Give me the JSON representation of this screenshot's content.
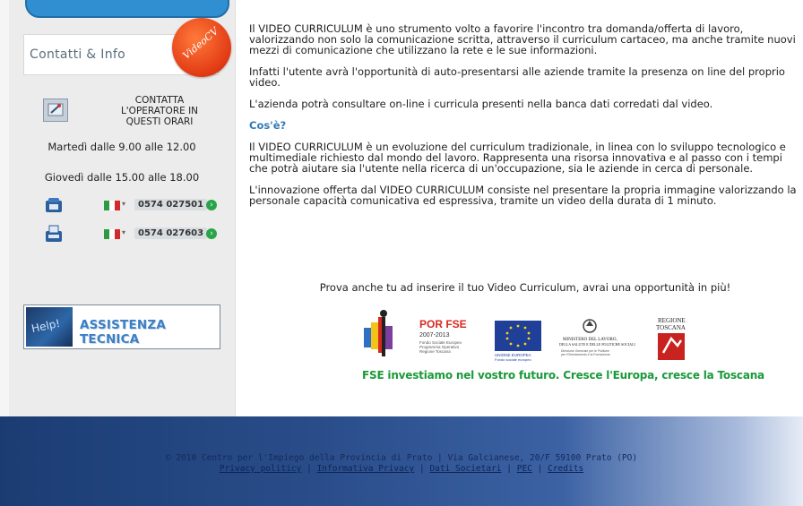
{
  "sidebar": {
    "contact_title": "Contatti & Info",
    "badge_text": "VideoCV",
    "operator_text": [
      "CONTATTA",
      "L'OPERATORE IN",
      "QUESTI ORARI"
    ],
    "hours": [
      "Martedì dalle 9.00 alle 12.00",
      "Giovedì dalle 15.00 alle 18.00"
    ],
    "phones": [
      {
        "icon": "telephone-icon",
        "number": "0574 027501"
      },
      {
        "icon": "fax-icon",
        "number": "0574 027603"
      }
    ],
    "assist_key_text": "Help!",
    "assist_label": "ASSISTENZA TECNICA"
  },
  "main": {
    "paragraphs": [
      "Il VIDEO CURRICULUM è uno strumento volto a favorire l'incontro tra domanda/offerta di lavoro, valorizzando non solo la comunicazione scritta, attraverso il curriculum cartaceo, ma anche tramite nuovi mezzi di comunicazione che utilizzano la rete e le sue informazioni.",
      "Infatti l'utente avrà l'opportunità di auto-presentarsi alle aziende tramite la presenza on line del proprio video.",
      "L'azienda potrà consultare on-line i curricula presenti nella banca dati corredati dal video."
    ],
    "heading": "Cos'è?",
    "paragraphs2": [
      "Il VIDEO CURRICULUM è un evoluzione del curriculum tradizionale, in linea con lo sviluppo tecnologico e multimediale richiesto dal mondo del lavoro. Rappresenta una risorsa innovativa e al passo con i tempi che potrà aiutare sia l'utente nella ricerca di un'occupazione, sia le aziende in cerca di personale.",
      "L'innovazione offerta dal VIDEO CURRICULUM consiste nel presentare la propria immagine valorizzando la personale capacità comunicativa ed espressiva, tramite un video della durata di 1 minuto."
    ],
    "prova": "Prova anche tu ad inserire il tuo Video Curriculum, avrai una opportunità in più!",
    "logos": {
      "por_fse": "POR FSE",
      "por_years": "2007-2013",
      "por_sub": [
        "Fondo Sociale Europeo",
        "Programma Operativo",
        "Regione Toscana"
      ],
      "eu_label": [
        "UNIONE EUROPEA",
        "Fondo sociale europeo"
      ],
      "ministero": [
        "MINISTERO DEL LAVORO,",
        "DELLA SALUTE E DELLE POLITICHE SOCIALI"
      ],
      "ministero_sub": [
        "Direzione Generale per le Politiche",
        "per l'Orientamento e la Formazione"
      ],
      "regione": [
        "REGIONE",
        "TOSCANA"
      ]
    },
    "fse_caption": "FSE investiamo nel vostro futuro. Cresce l'Europa, cresce la Toscana"
  },
  "footer": {
    "copyright": "© 2010 Centro per l'Impiego della Provincia di Prato | Via Galcianese, 20/F 59100 Prato (PO)",
    "links": [
      "Privacy politicy",
      "Informativa Privacy",
      "Dati Societari",
      "PEC",
      "Credits"
    ],
    "separator": "|"
  },
  "colors": {
    "accent_blue": "#2f7ab8",
    "fse_green": "#1a9a3a",
    "footer_dark": "#1b3c73",
    "badge_orange": "#e23a14"
  }
}
